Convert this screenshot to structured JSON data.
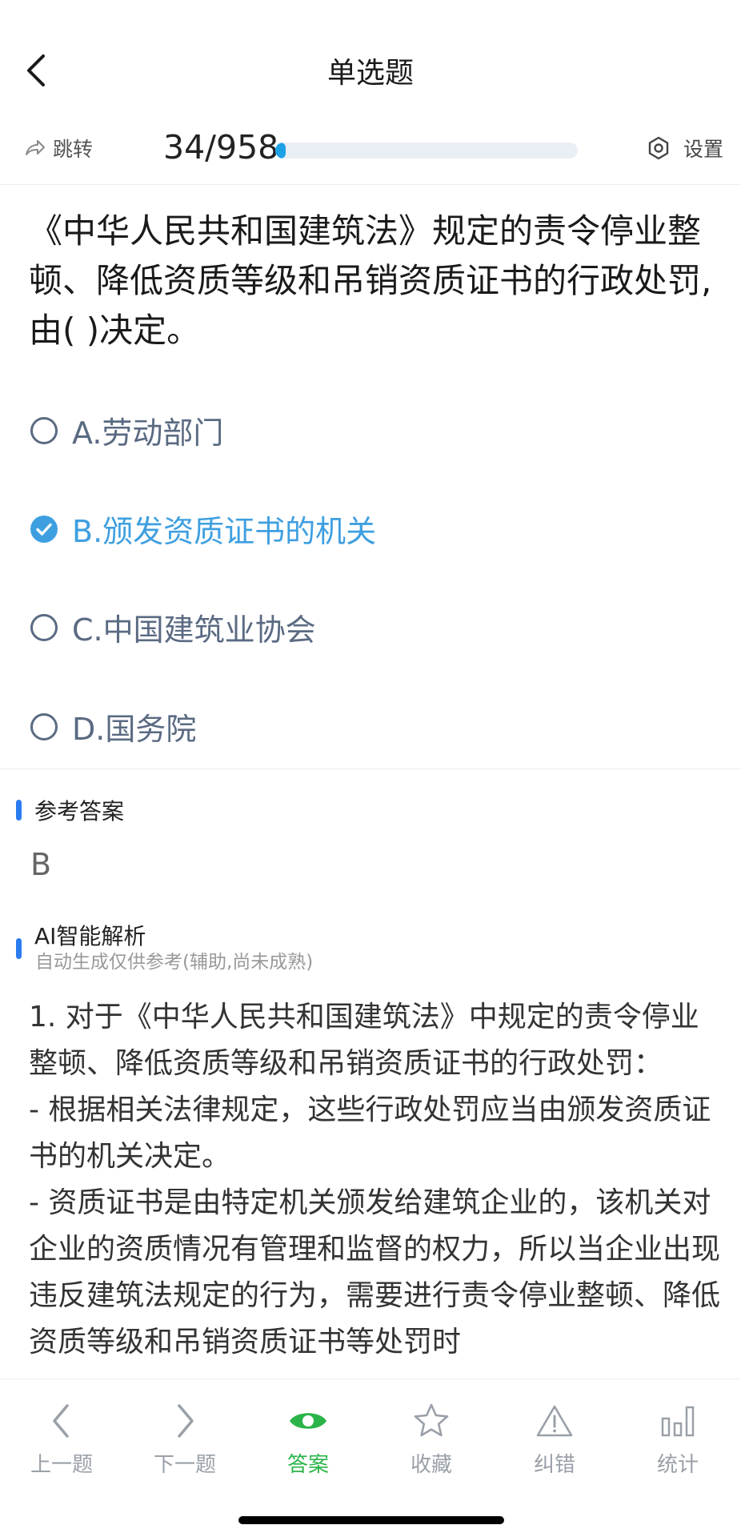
{
  "nav": {
    "title": "单选题"
  },
  "progress": {
    "jump_label": "跳转",
    "current": "34/958",
    "fraction": 0.0355,
    "settings_label": "设置"
  },
  "question": {
    "text": "《中华人民共和国建筑法》规定的责令停业整顿、降低资质等级和吊销资质证书的行政处罚,由( )决定。"
  },
  "options": [
    {
      "label": "A.劳动部门",
      "selected": false
    },
    {
      "label": "B.颁发资质证书的机关",
      "selected": true
    },
    {
      "label": "C.中国建筑业协会",
      "selected": false
    },
    {
      "label": "D.国务院",
      "selected": false
    }
  ],
  "answer": {
    "section_label": "参考答案",
    "value": "B"
  },
  "ai": {
    "section_label": "AI智能解析",
    "subtitle": "自动生成仅供参考(辅助,尚未成熟)",
    "text": "1. 对于《中华人民共和国建筑法》中规定的责令停业整顿、降低资质等级和吊销资质证书的行政处罚：\n- 根据相关法律规定，这些行政处罚应当由颁发资质证书的机关决定。\n- 资质证书是由特定机关颁发给建筑企业的，该机关对企业的资质情况有管理和监督的权力，所以当企业出现违反建筑法规定的行为，需要进行责令停业整顿、降低资质等级和吊销资质证书等处罚时"
  },
  "toolbar": {
    "prev": "上一题",
    "next": "下一题",
    "answer": "答案",
    "favorite": "收藏",
    "report": "纠错",
    "stats": "统计"
  },
  "colors": {
    "selected": "#3e9fe0",
    "active_tool": "#2bb44a",
    "progress": "#1da1e6",
    "section_mark": "#2b7cf0"
  }
}
